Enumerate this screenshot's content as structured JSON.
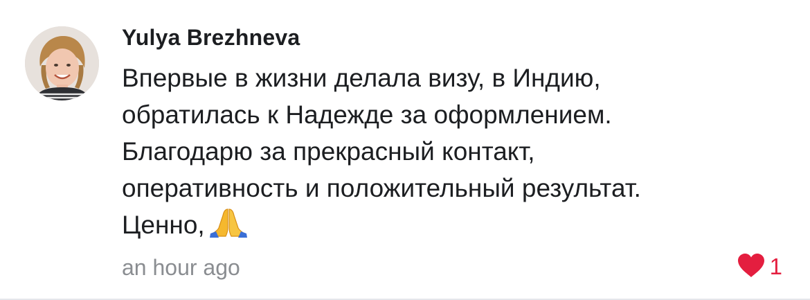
{
  "comment": {
    "author": "Yulya Brezhneva",
    "lines": [
      "Впервые в жизни делала визу, в Индию,",
      "обратилась к Надежде за оформлением.",
      "Благодарю за прекрасный контакт,",
      "оперативность и положительный результат.",
      "Ценно,"
    ],
    "emoji": "pray-hands-emoji",
    "timestamp": "an hour ago",
    "like_count": "1",
    "like_icon": "heart-icon",
    "like_color": "#e41e3f"
  }
}
